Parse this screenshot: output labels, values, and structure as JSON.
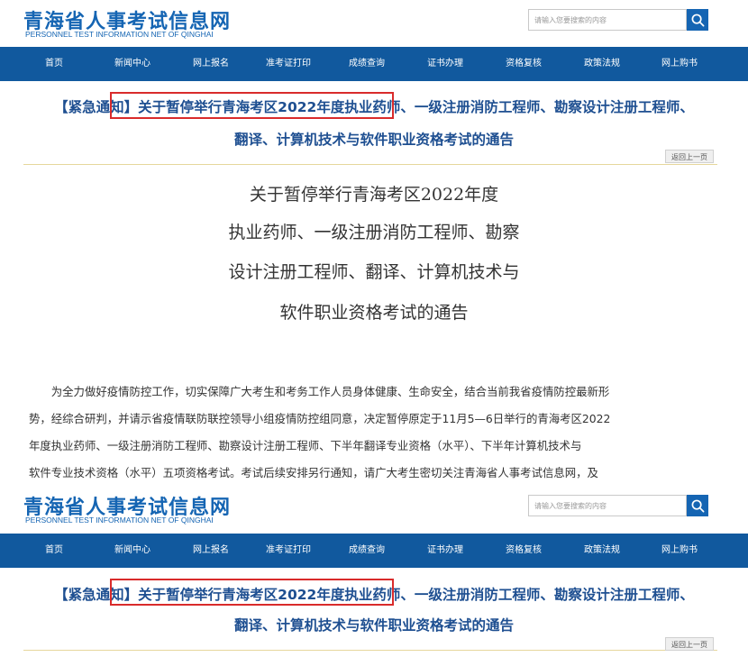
{
  "site": {
    "logo_title": "青海省人事考试信息网",
    "logo_subtitle": "PERSONNEL TEST INFORMATION NET OF QINGHAI",
    "brand_color": "#1565b3",
    "nav_color": "#11599e"
  },
  "search": {
    "placeholder": "请输入您要搜索的内容",
    "icon": "search-icon"
  },
  "nav": {
    "items": [
      "首页",
      "新闻中心",
      "网上报名",
      "准考证打印",
      "成绩查询",
      "证书办理",
      "资格复核",
      "政策法规",
      "网上购书"
    ]
  },
  "article": {
    "headline_line1": "【紧急通知】关于暂停举行青海考区2022年度执业药师、一级注册消防工程师、勘察设计注册工程师、",
    "headline_line2": "翻译、计算机技术与软件职业资格考试的通告",
    "back_label": "返回上一页",
    "highlight_color": "#d92b2b",
    "title_lines": [
      "关于暂停举行青海考区2022年度",
      "执业药师、一级注册消防工程师、勘察",
      "设计注册工程师、翻译、计算机技术与",
      "软件职业资格考试的通告"
    ],
    "body_lines": [
      "　　为全力做好疫情防控工作，切实保障广大考生和考务工作人员身体健康、生命安全，结合当前我省疫情防控最新形",
      "势，经综合研判，并请示省疫情联防联控领导小组疫情防控组同意，决定暂停原定于11月5—6日举行的青海考区2022",
      "年度执业药师、一级注册消防工程师、勘察设计注册工程师、下半年翻译专业资格（水平）、下半年计算机技术与",
      "软件专业技术资格（水平）五项资格考试。考试后续安排另行通知，请广大考生密切关注青海省人事考试信息网，及"
    ]
  }
}
